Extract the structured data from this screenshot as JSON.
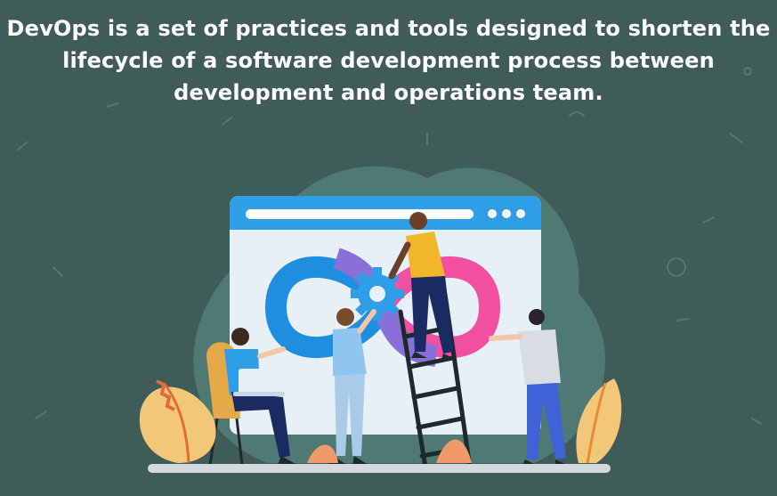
{
  "headline": {
    "line1": "DevOps is a set of practices and tools designed to shorten the",
    "line2": "lifecycle of a software development process between",
    "line3": "development and operations team."
  },
  "colors": {
    "background": "#3f5c59",
    "browser_bar": "#2f9ee8",
    "infinity_blue": "#1e8fe0",
    "infinity_purple": "#8a6fd6",
    "infinity_pink": "#f0509f",
    "accent_yellow": "#f2b62a"
  },
  "icons": [
    "browser-window-icon",
    "infinity-loop-icon",
    "gear-icon",
    "ladder-icon",
    "laptop-icon",
    "chair-icon",
    "plant-icon"
  ]
}
